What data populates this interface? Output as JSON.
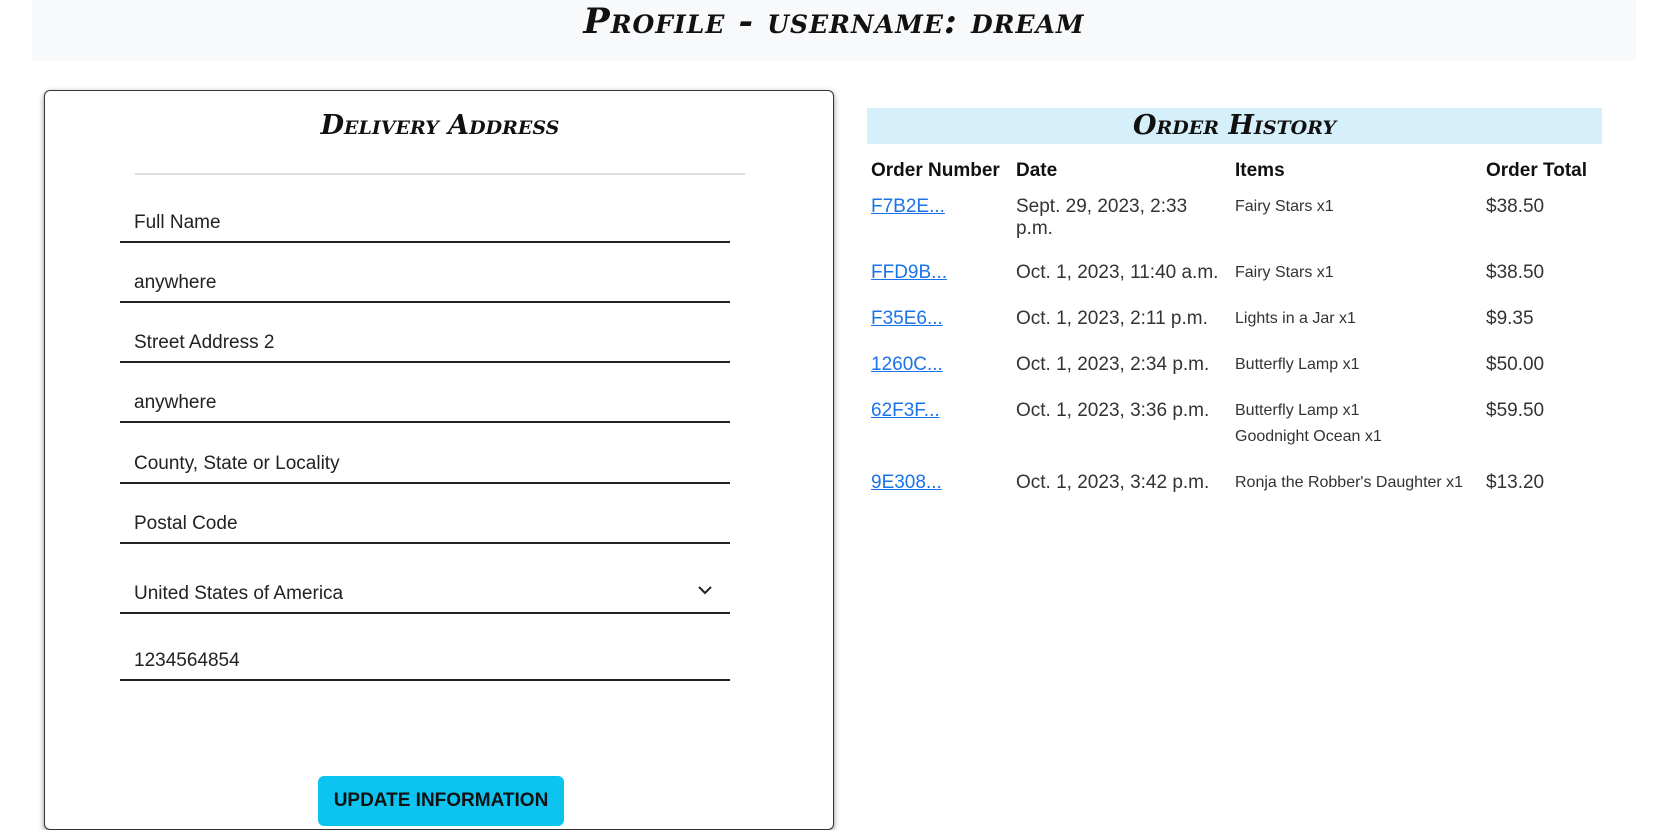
{
  "header": {
    "title": "Profile - username: dream"
  },
  "delivery": {
    "title": "Delivery Address",
    "fields": {
      "full_name": {
        "placeholder": "Full Name",
        "value": ""
      },
      "street1": {
        "placeholder": "",
        "value": "anywhere"
      },
      "street2": {
        "placeholder": "Street Address 2",
        "value": ""
      },
      "town": {
        "placeholder": "",
        "value": "anywhere"
      },
      "county": {
        "placeholder": "County, State or Locality",
        "value": ""
      },
      "postcode": {
        "placeholder": "Postal Code",
        "value": ""
      },
      "country": {
        "value": "United States of America"
      },
      "phone": {
        "placeholder": "",
        "value": "1234564854"
      }
    },
    "update_label": "UPDATE INFORMATION"
  },
  "history": {
    "title": "Order History",
    "columns": [
      "Order Number",
      "Date",
      "Items",
      "Order Total"
    ],
    "orders": [
      {
        "number": "F7B2E...",
        "date": "Sept. 29, 2023, 2:33 p.m.",
        "items": [
          "Fairy Stars x1"
        ],
        "total": "$38.50"
      },
      {
        "number": "FFD9B...",
        "date": "Oct. 1, 2023, 11:40 a.m.",
        "items": [
          "Fairy Stars x1"
        ],
        "total": "$38.50"
      },
      {
        "number": "F35E6...",
        "date": "Oct. 1, 2023, 2:11 p.m.",
        "items": [
          "Lights in a Jar x1"
        ],
        "total": "$9.35"
      },
      {
        "number": "1260C...",
        "date": "Oct. 1, 2023, 2:34 p.m.",
        "items": [
          "Butterfly Lamp x1"
        ],
        "total": "$50.00"
      },
      {
        "number": "62F3F...",
        "date": "Oct. 1, 2023, 3:36 p.m.",
        "items": [
          "Butterfly Lamp x1",
          "Goodnight Ocean x1"
        ],
        "total": "$59.50"
      },
      {
        "number": "9E308...",
        "date": "Oct. 1, 2023, 3:42 p.m.",
        "items": [
          "Ronja the Robber's Daughter x1"
        ],
        "total": "$13.20"
      }
    ]
  }
}
